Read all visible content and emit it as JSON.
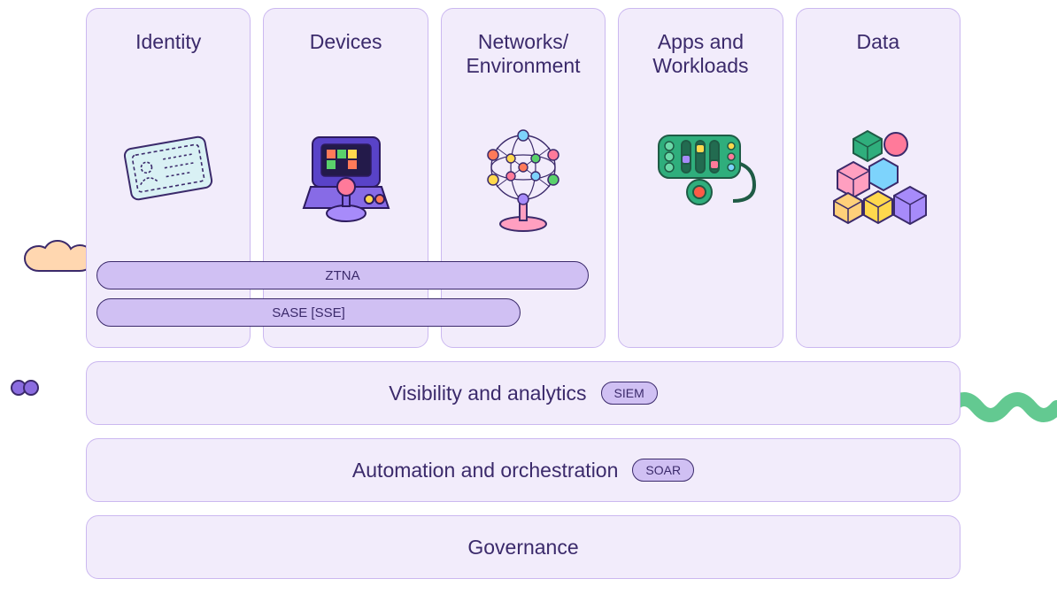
{
  "pillars": [
    {
      "title": "Identity",
      "icon": "id-card-icon"
    },
    {
      "title": "Devices",
      "icon": "arcade-icon"
    },
    {
      "title": "Networks/\nEnvironment",
      "icon": "network-globe-icon"
    },
    {
      "title": "Apps and\nWorkloads",
      "icon": "controller-icon"
    },
    {
      "title": "Data",
      "icon": "blocks-icon"
    }
  ],
  "overlays": {
    "ztna": "ZTNA",
    "sase": "SASE [SSE]"
  },
  "rows": [
    {
      "label": "Visibility and analytics",
      "badge": "SIEM"
    },
    {
      "label": "Automation and orchestration",
      "badge": "SOAR"
    },
    {
      "label": "Governance",
      "badge": null
    }
  ],
  "decor": {
    "cloud": "cloud-blob-icon",
    "purple": "purple-blob-icon",
    "green": "green-wave-icon"
  }
}
